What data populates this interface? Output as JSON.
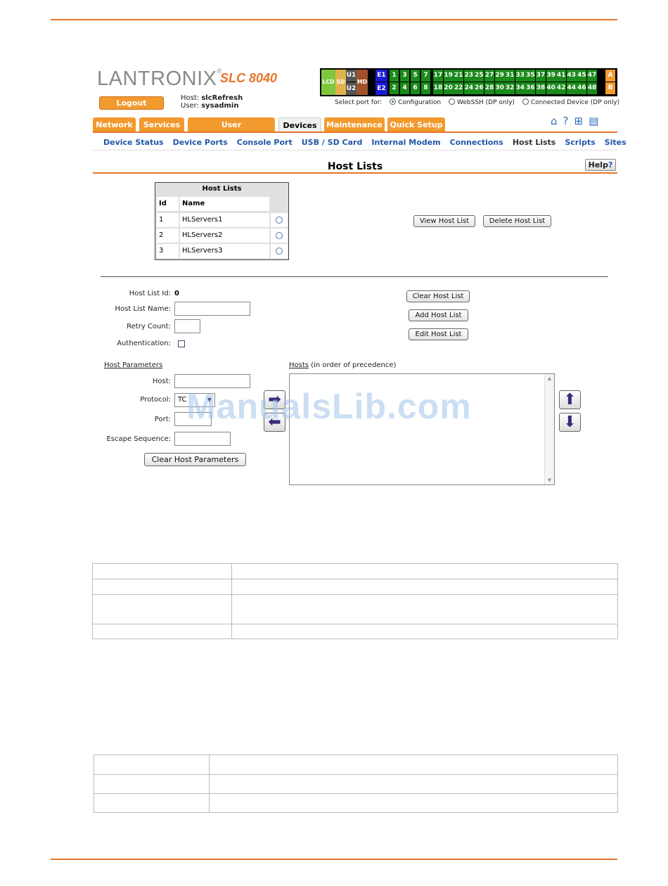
{
  "brand": {
    "logo_text": "LANTRONIX",
    "model": "SLC 8040"
  },
  "session": {
    "logout_label": "Logout",
    "host_label": "Host:",
    "host_value": "slcRefresh",
    "user_label": "User:",
    "user_value": "sysadmin"
  },
  "port_panel": {
    "lcd": "LCD",
    "sd": "SD",
    "u1": "U1",
    "u2": "U2",
    "md": "MD",
    "e1": "E1",
    "e2": "E2",
    "top_ports": [
      "1",
      "3",
      "5",
      "7",
      "17",
      "19",
      "21",
      "23",
      "25",
      "27",
      "29",
      "31",
      "33",
      "35",
      "37",
      "39",
      "41",
      "43",
      "45",
      "47"
    ],
    "bottom_ports": [
      "2",
      "4",
      "6",
      "8",
      "18",
      "20",
      "22",
      "24",
      "26",
      "28",
      "30",
      "32",
      "34",
      "36",
      "38",
      "40",
      "42",
      "44",
      "46",
      "48"
    ],
    "a": "A",
    "b": "B",
    "select_label": "Select port for:",
    "options": [
      "Configuration",
      "WebSSH (DP only)",
      "Connected Device (DP only)"
    ],
    "selected": "Configuration"
  },
  "tabs": [
    "Network",
    "Services",
    "User Authentication",
    "Devices",
    "Maintenance",
    "Quick Setup"
  ],
  "active_tab": "Devices",
  "subnav": [
    "Device Status",
    "Device Ports",
    "Console Port",
    "USB / SD Card",
    "Internal Modem",
    "Connections",
    "Host Lists",
    "Scripts",
    "Sites"
  ],
  "active_subnav": "Host Lists",
  "page_title": "Host Lists",
  "help_label": "Help",
  "host_lists_table": {
    "title": "Host Lists",
    "headers": [
      "Id",
      "Name"
    ],
    "rows": [
      {
        "id": "1",
        "name": "HLServers1"
      },
      {
        "id": "2",
        "name": "HLServers2"
      },
      {
        "id": "3",
        "name": "HLServers3"
      }
    ]
  },
  "list_actions": {
    "view": "View Host List",
    "delete": "Delete Host List"
  },
  "form": {
    "host_list_id_label": "Host List Id:",
    "host_list_id_value": "0",
    "host_list_name_label": "Host List Name:",
    "retry_count_label": "Retry Count:",
    "authentication_label": "Authentication:",
    "clear_host_list": "Clear Host List",
    "add_host_list": "Add Host List",
    "edit_host_list": "Edit Host List",
    "host_parameters_label": "Host Parameters",
    "host_label": "Host:",
    "protocol_label": "Protocol:",
    "protocol_value": "TC",
    "port_label": "Port:",
    "escape_sequence_label": "Escape Sequence:",
    "clear_host_parameters": "Clear Host Parameters",
    "hosts_label": "Hosts",
    "hosts_note": "(in order of precedence)"
  },
  "watermark": "ManualsLib.com",
  "icons": {
    "home": "home-icon",
    "help": "question-icon",
    "sitemap": "sitemap-icon",
    "log": "log-icon",
    "move_right": "arrow-right-icon",
    "move_left": "arrow-left-icon",
    "move_up": "arrow-up-icon",
    "move_down": "arrow-down-icon"
  },
  "colors": {
    "accent": "#e8742a",
    "tab": "#f29a2e",
    "link": "#2157a8",
    "port_green": "#1a8a1a",
    "port_blue": "#1a1ad6"
  }
}
